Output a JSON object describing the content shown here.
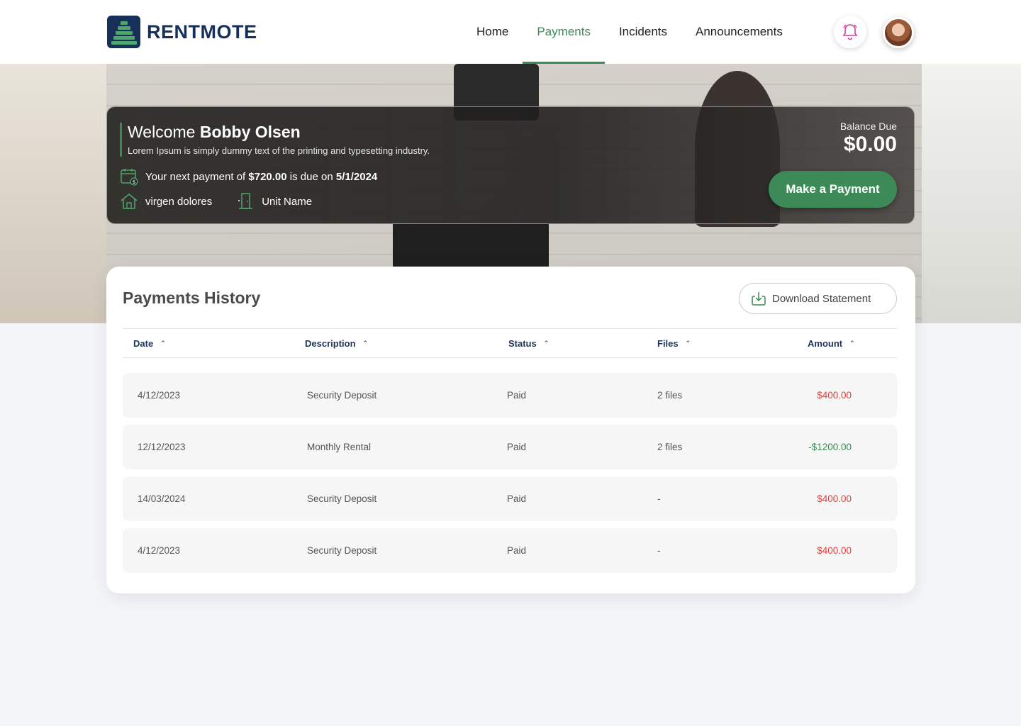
{
  "brand": {
    "name": "RENTMOTE",
    "colors": {
      "primary": "#16305a",
      "accent": "#3b8a57",
      "danger": "#e0413f"
    }
  },
  "nav": {
    "items": [
      {
        "label": "Home",
        "active": false
      },
      {
        "label": "Payments",
        "active": true
      },
      {
        "label": "Incidents",
        "active": false
      },
      {
        "label": "Announcements",
        "active": false
      }
    ]
  },
  "header": {
    "bell_icon": "bell-icon",
    "avatar": "user-avatar"
  },
  "welcome": {
    "greeting": "Welcome",
    "name": "Bobby Olsen",
    "subtitle": "Lorem Ipsum is simply dummy text of the printing and typesetting industry.",
    "payment_prefix": "Your next payment of",
    "payment_amount": "$720.00",
    "payment_mid": "is due on",
    "payment_date": "5/1/2024",
    "property": "virgen dolores",
    "unit": "Unit Name",
    "balance_label": "Balance Due",
    "balance_value": "$0.00",
    "pay_button": "Make a Payment"
  },
  "history": {
    "title": "Payments History",
    "download_label": "Download Statement",
    "columns": [
      "Date",
      "Description",
      "Status",
      "Files",
      "Amount"
    ],
    "rows": [
      {
        "date": "4/12/2023",
        "description": "Security Deposit",
        "status": "Paid",
        "files": "2 files",
        "amount": "$400.00",
        "type": "debit"
      },
      {
        "date": "12/12/2023",
        "description": "Monthly Rental",
        "status": "Paid",
        "files": "2 files",
        "amount": "-$1200.00",
        "type": "credit"
      },
      {
        "date": "14/03/2024",
        "description": "Security Deposit",
        "status": "Paid",
        "files": "-",
        "amount": "$400.00",
        "type": "debit"
      },
      {
        "date": "4/12/2023",
        "description": "Security Deposit",
        "status": "Paid",
        "files": "-",
        "amount": "$400.00",
        "type": "debit"
      }
    ]
  }
}
